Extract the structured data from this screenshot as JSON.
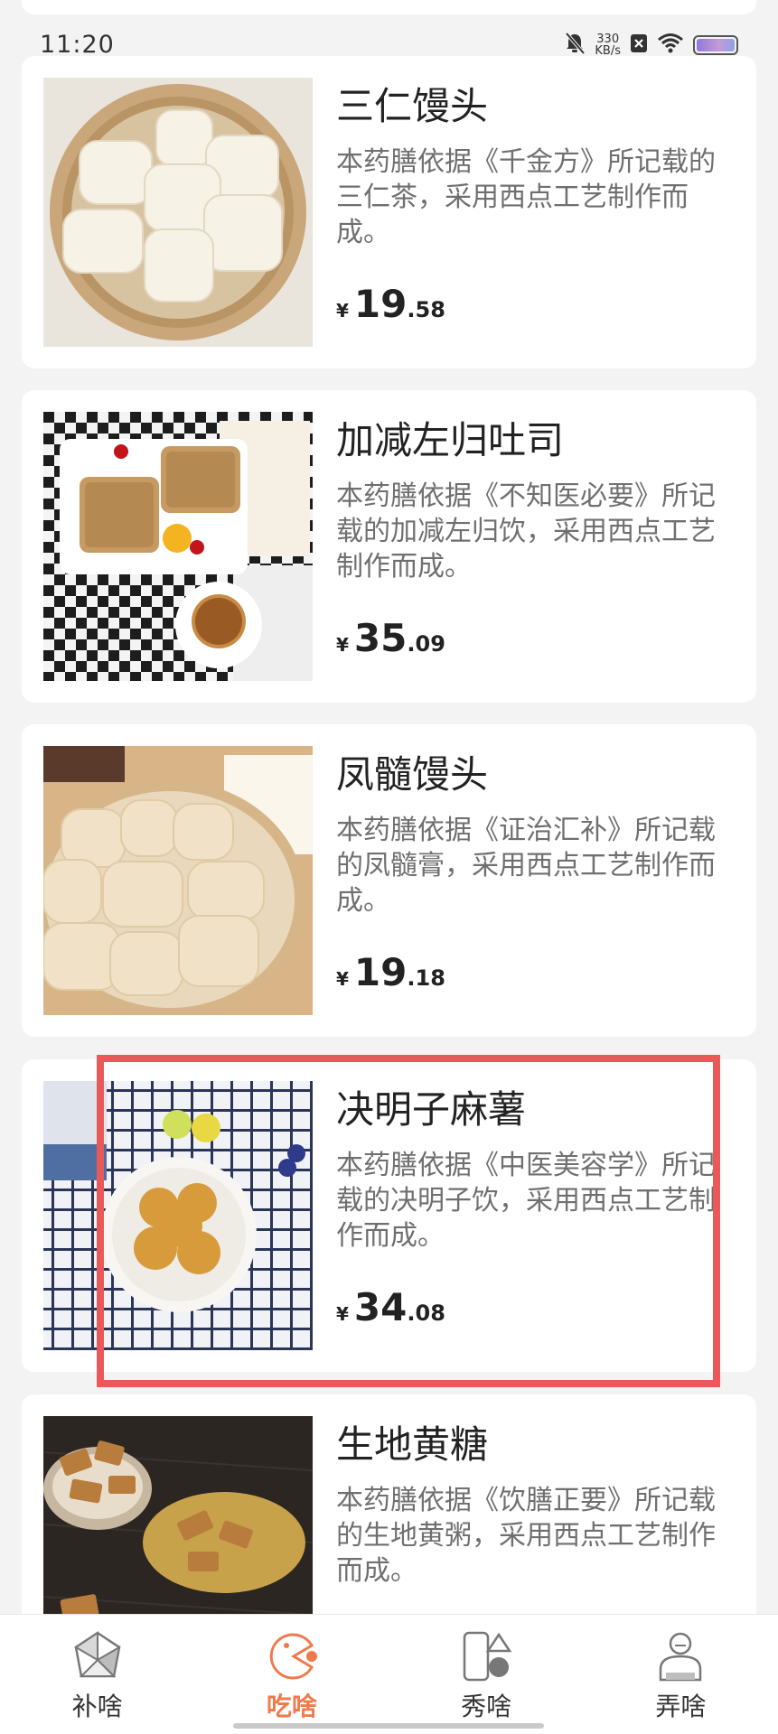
{
  "status_bar": {
    "time": "11:20",
    "network_speed_value": "330",
    "network_speed_unit": "KB/s",
    "icons": [
      "mute-bell-icon",
      "sim-x-icon",
      "wifi-icon",
      "battery-icon"
    ]
  },
  "products": [
    {
      "title": "三仁馒头",
      "description": "本药膳依据《千金方》所记载的三仁茶，采用西点工艺制作而成。",
      "price_symbol": "¥",
      "price_int": "19",
      "price_dec": ".58",
      "image": "steamed-buns-in-bamboo-steamer"
    },
    {
      "title": "加减左归吐司",
      "description": "本药膳依据《不知医必要》所记载的加减左归饮，采用西点工艺制作而成。",
      "price_symbol": "¥",
      "price_int": "35",
      "price_dec": ".09",
      "image": "toast-slices-on-tray"
    },
    {
      "title": "凤髓馒头",
      "description": "本药膳依据《证治汇补》所记载的凤髓膏，采用西点工艺制作而成。",
      "price_symbol": "¥",
      "price_int": "19",
      "price_dec": ".18",
      "image": "buns-in-steamer-with-box"
    },
    {
      "title": "决明子麻薯",
      "description": "本药膳依据《中医美容学》所记载的决明子饮，采用西点工艺制作而成。",
      "price_symbol": "¥",
      "price_int": "34",
      "price_dec": ".08",
      "image": "mochi-balls-on-plate"
    },
    {
      "title": "生地黄糖",
      "description": "本药膳依据《饮膳正要》所记载的生地黄粥，采用西点工艺制作而成。",
      "image": "sesame-candy-pieces"
    }
  ],
  "bottom_nav": {
    "items": [
      {
        "label": "补啥",
        "icon": "pinwheel-icon"
      },
      {
        "label": "吃啥",
        "icon": "pacman-icon",
        "active": true
      },
      {
        "label": "秀啥",
        "icon": "shapes-icon"
      },
      {
        "label": "弄啥",
        "icon": "person-icon"
      }
    ],
    "active_color": "#ef7a4d"
  },
  "highlight_color": "#e85a5a"
}
